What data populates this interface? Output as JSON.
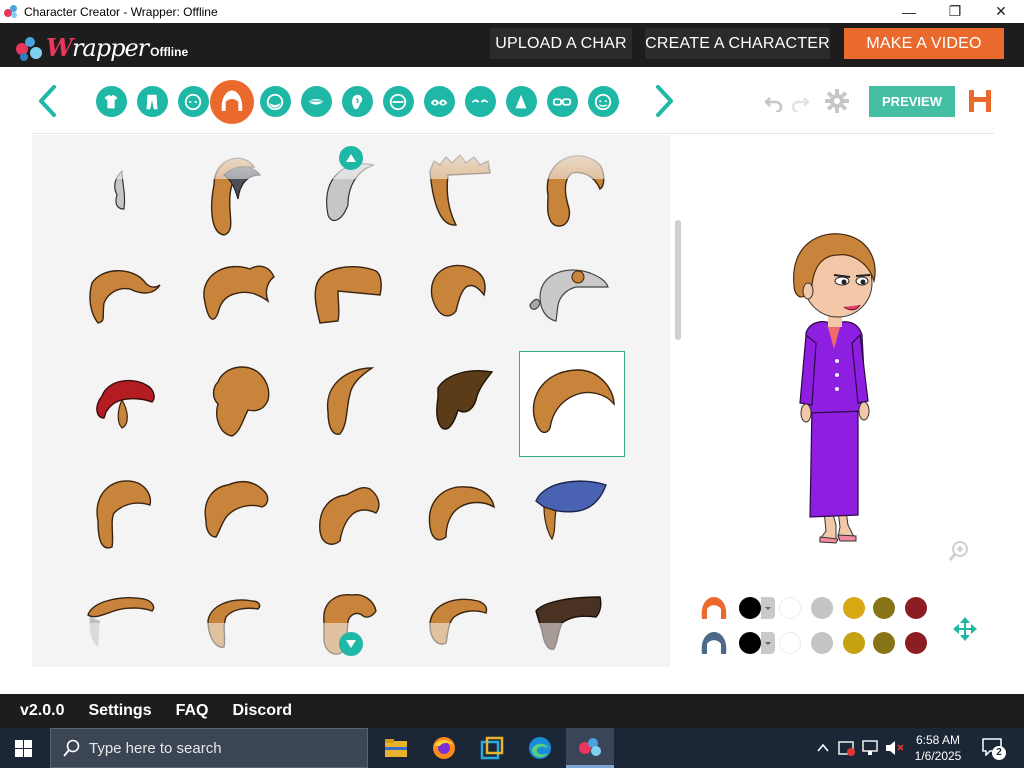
{
  "window": {
    "title": "Character Creator - Wrapper: Offline",
    "minimize": "—",
    "maximize": "❐",
    "close": "✕"
  },
  "header": {
    "logo_prefix": "W",
    "logo_rest": "rapper",
    "logo_suffix": "Offline",
    "upload_label": "UPLOAD A CHAR",
    "create_label": "CREATE A CHARACTER",
    "make_video_label": "MAKE A VIDEO"
  },
  "toolbar": {
    "categories": [
      "shirt-icon",
      "pants-icon",
      "head-shape-icon",
      "hair-icon",
      "beard-icon",
      "mouth-icon",
      "ear-icon",
      "face-icon",
      "eyes-icon",
      "eyebrows-icon",
      "nose-icon",
      "glasses-icon",
      "skin-icon"
    ],
    "active_category": "hair-icon",
    "preview_label": "PREVIEW"
  },
  "grid": {
    "selected_index": 14,
    "hair_color": "#c8843a",
    "item_count": 25
  },
  "palette": {
    "rows": [
      {
        "part": "hair-color-icon",
        "colors": [
          "#000000",
          "#ffffff",
          "#c4c4c4",
          "#d8a815",
          "#867416",
          "#8b1e22"
        ]
      },
      {
        "part": "hair-secondary-icon",
        "colors": [
          "#000000",
          "#ffffff",
          "#c4c4c4",
          "#c4a212",
          "#867416",
          "#8b1e22"
        ]
      }
    ]
  },
  "footer": {
    "version": "v2.0.0",
    "settings": "Settings",
    "faq": "FAQ",
    "discord": "Discord"
  },
  "taskbar": {
    "search_placeholder": "Type here to search",
    "time": "6:58 AM",
    "date": "1/6/2025",
    "notification_count": "2"
  }
}
